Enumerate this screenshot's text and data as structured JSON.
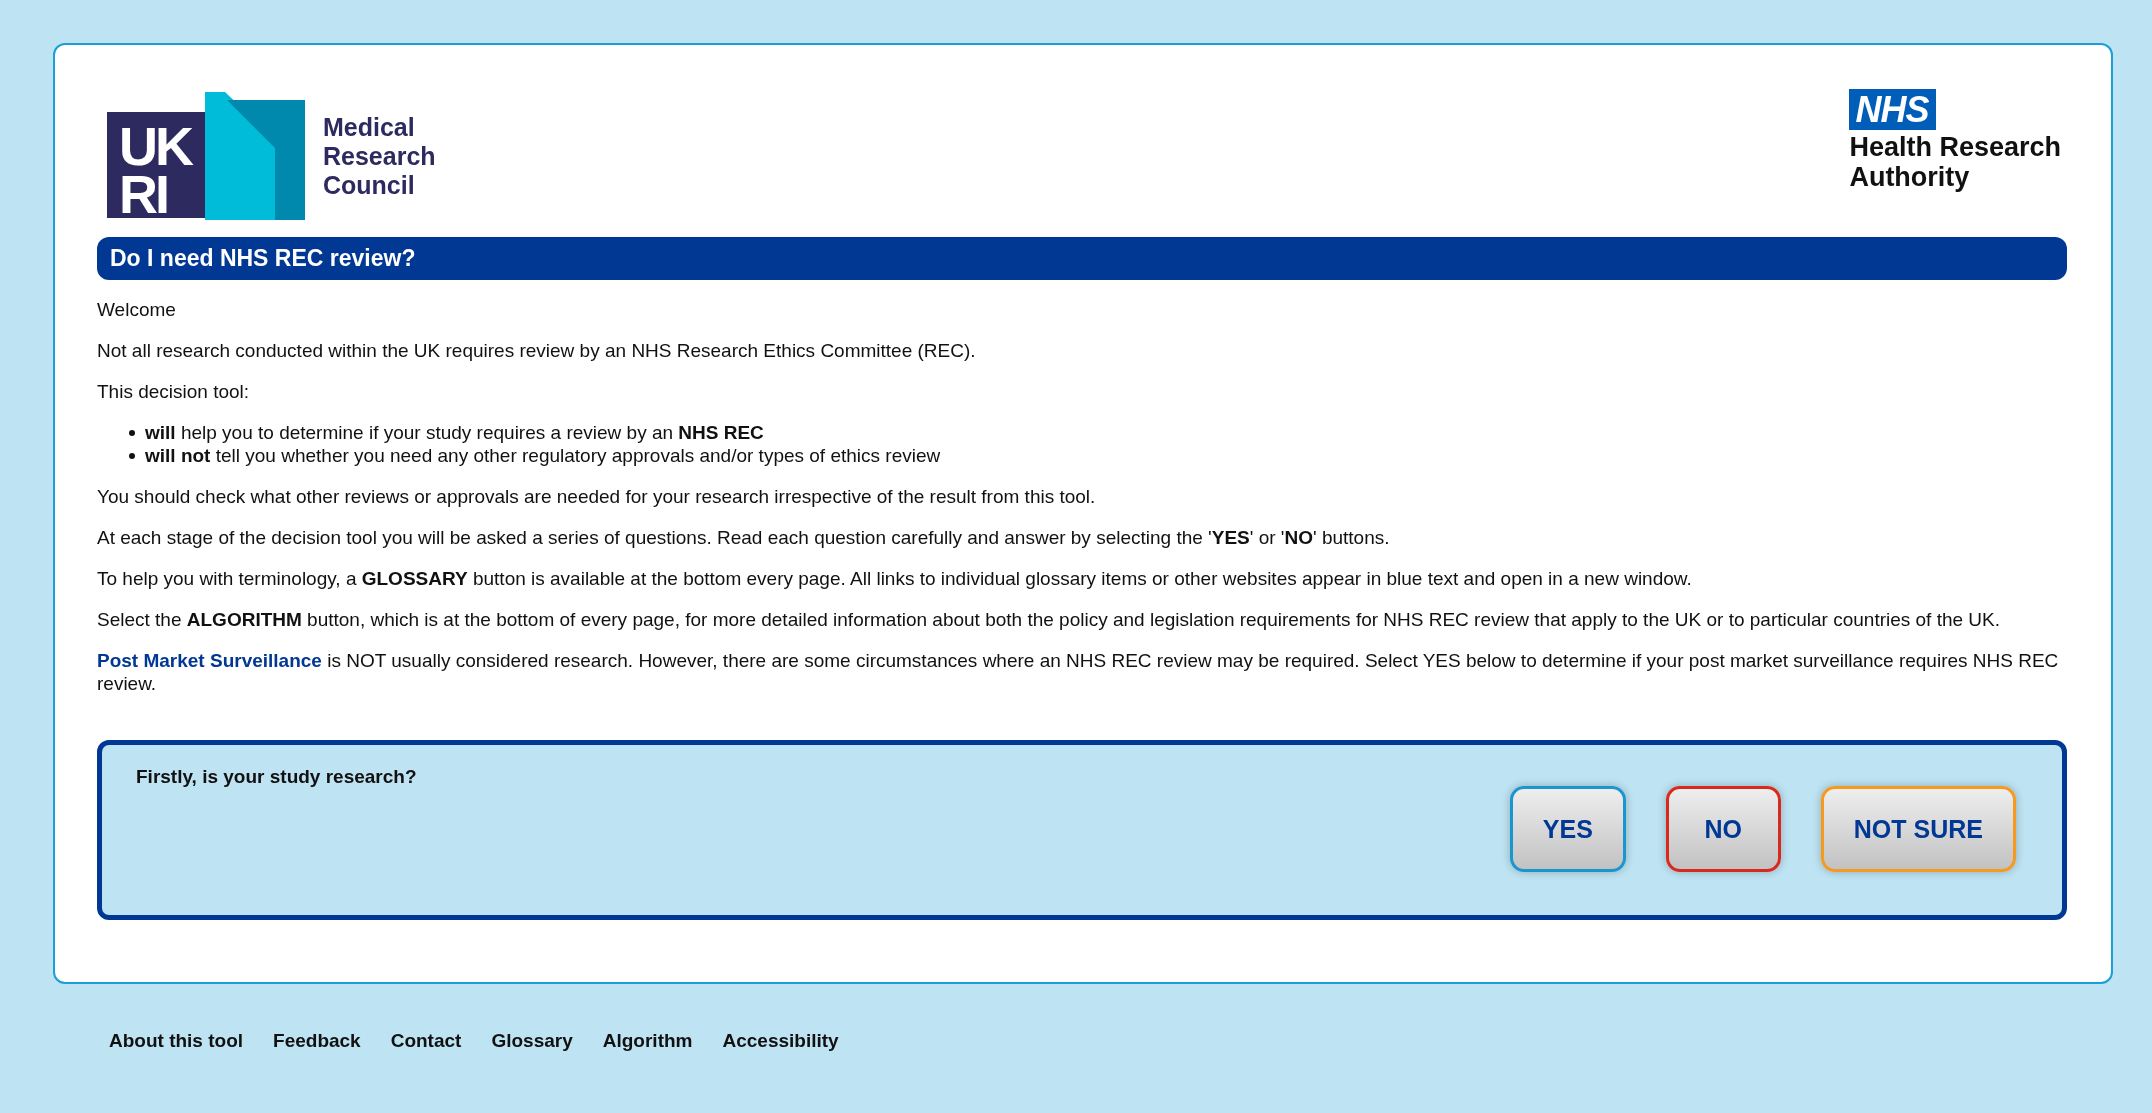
{
  "header": {
    "left_logo": {
      "mark_lines": [
        "UK",
        "RI"
      ],
      "name_lines": [
        "Medical",
        "Research",
        "Council"
      ]
    },
    "right_logo": {
      "badge": "NHS",
      "name_lines": [
        "Health Research",
        "Authority"
      ]
    }
  },
  "title": "Do I need NHS REC review?",
  "intro": [
    "Welcome",
    "Not all research conducted within the UK requires review by an NHS Research Ethics Committee (REC).",
    "This decision tool:"
  ],
  "bullets": [
    "**will** help you to determine if your study requires a review by an **NHS REC**",
    "**will not** tell you whether you need any other regulatory approvals and/or types of ethics review"
  ],
  "paragraphs": [
    "You should check what other reviews or approvals are needed for your research irrespective of the result from this tool.",
    "At each stage of the decision tool you will be asked a series of questions. Read each question carefully and answer by selecting the '**YES**' or '**NO**' buttons.",
    "To help you with terminology, a **GLOSSARY** button is available at the bottom every page. All links to individual glossary items or other websites appear in blue text and open in a new window.",
    "Select the **ALGORITHM** button, which is at the bottom of every page, for more detailed information about both the policy and legislation requirements for NHS REC review that apply to the UK or to particular countries of the UK."
  ],
  "link_paragraph": {
    "link": "Post Market Surveillance",
    "text": " is NOT usually considered research. However, there are some circumstances where an NHS REC review may be required. Select YES below to determine if your post market surveillance requires NHS REC review."
  },
  "question": {
    "text": "Firstly, is your study research?",
    "buttons": [
      {
        "label": "YES",
        "color": "#1a96cf"
      },
      {
        "label": "NO",
        "color": "#d9281c"
      },
      {
        "label": "NOT SURE",
        "color": "#f59a1f"
      }
    ]
  },
  "footer_links": [
    "About this tool",
    "Feedback",
    "Contact",
    "Glossary",
    "Algorithm",
    "Accessibility"
  ]
}
